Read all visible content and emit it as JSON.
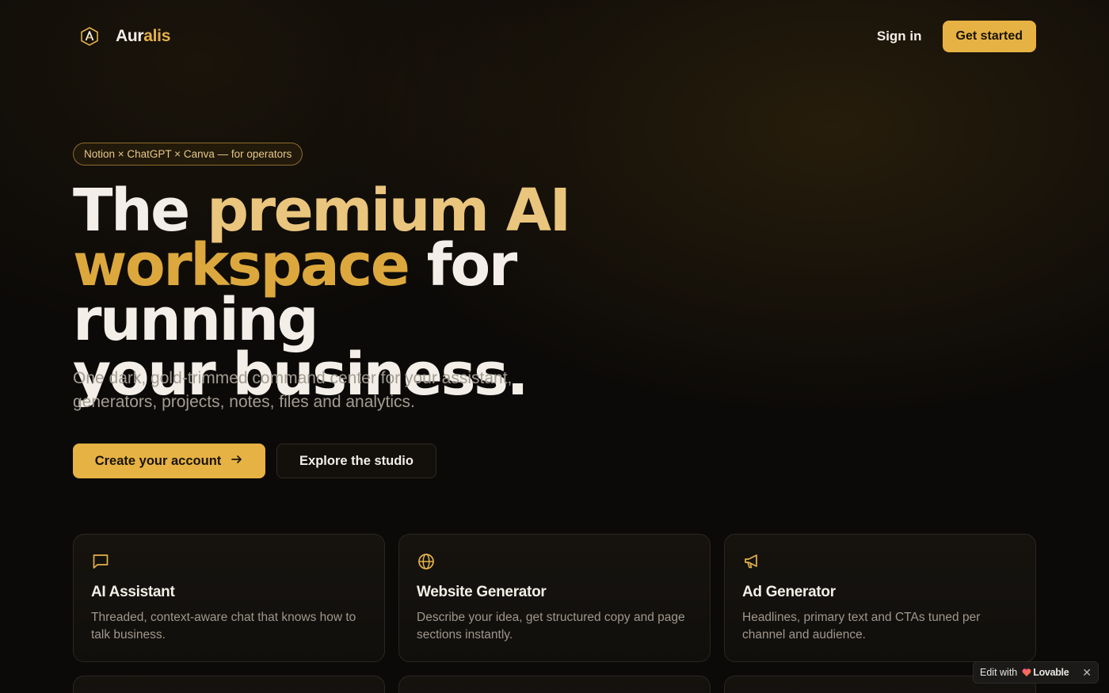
{
  "header": {
    "brand_prefix": "Aur",
    "brand_suffix": "alis",
    "sign_in": "Sign in",
    "get_started": "Get started"
  },
  "hero": {
    "badge": "Notion × ChatGPT × Canva — for operators",
    "headline": {
      "part1": "The ",
      "part2": "premium AI",
      "part3": "workspace",
      "part4": " for running",
      "part5": "your business."
    },
    "subtitle": "One dark, gold-trimmed command center for your assistant, generators, projects, notes, files and analytics.",
    "primary_cta": "Create your account",
    "secondary_cta": "Explore the studio"
  },
  "features": [
    {
      "icon": "message-square-icon",
      "title": "AI Assistant",
      "desc": "Threaded, context-aware chat that knows how to talk business."
    },
    {
      "icon": "globe-icon",
      "title": "Website Generator",
      "desc": "Describe your idea, get structured copy and page sections instantly."
    },
    {
      "icon": "megaphone-icon",
      "title": "Ad Generator",
      "desc": "Headlines, primary text and CTAs tuned per channel and audience."
    }
  ],
  "lovable": {
    "edit": "Edit with",
    "brand": "Lovable",
    "close": "✕"
  },
  "colors": {
    "gold": "#e6b243",
    "gold_light": "#eac57d",
    "background": "#0c0a08"
  }
}
